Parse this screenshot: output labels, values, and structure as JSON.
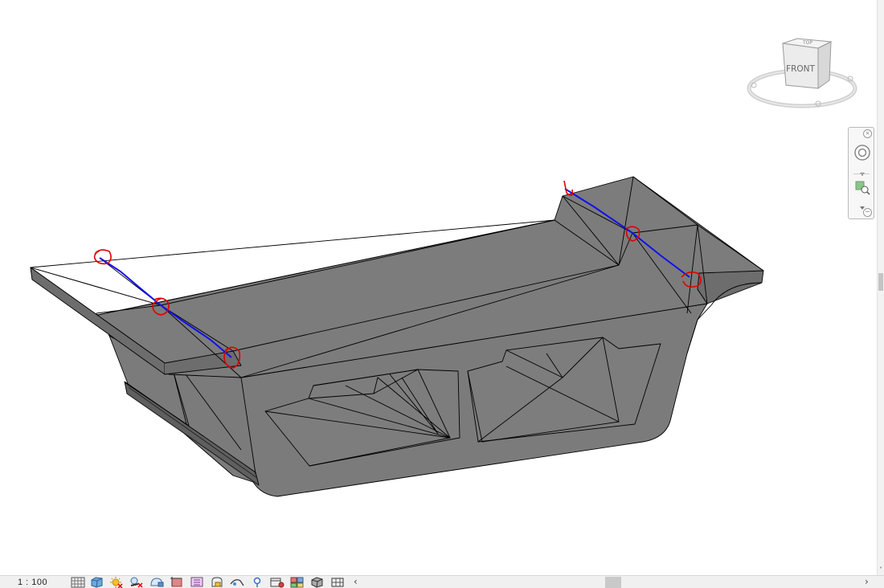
{
  "view": {
    "viewcube_face": "FRONT",
    "viewcube_top": "TOP",
    "model_color": "#7a7a7a",
    "markup_line_color": "#0000ee",
    "markup_circle_color": "#e00000"
  },
  "navigation_bar": {
    "close_glyph": "×",
    "minimize_glyph": "−",
    "tools": [
      "steering-wheel-icon",
      "zoom-region-icon"
    ]
  },
  "status_bar": {
    "scale": "1 : 100",
    "view_controls": [
      "detail-level-icon",
      "visual-style-icon",
      "sun-path-icon",
      "shadows-icon",
      "render-icon",
      "crop-view-icon",
      "show-crop-region-icon",
      "unlock-3d-view-icon",
      "temporary-hide-icon",
      "reveal-hidden-icon",
      "temporary-view-properties-icon",
      "worksharing-display-icon",
      "highlight-displacement-icon",
      "analytical-model-icon"
    ],
    "scroll_left_glyph": "‹",
    "scroll_right_glyph": "›"
  }
}
